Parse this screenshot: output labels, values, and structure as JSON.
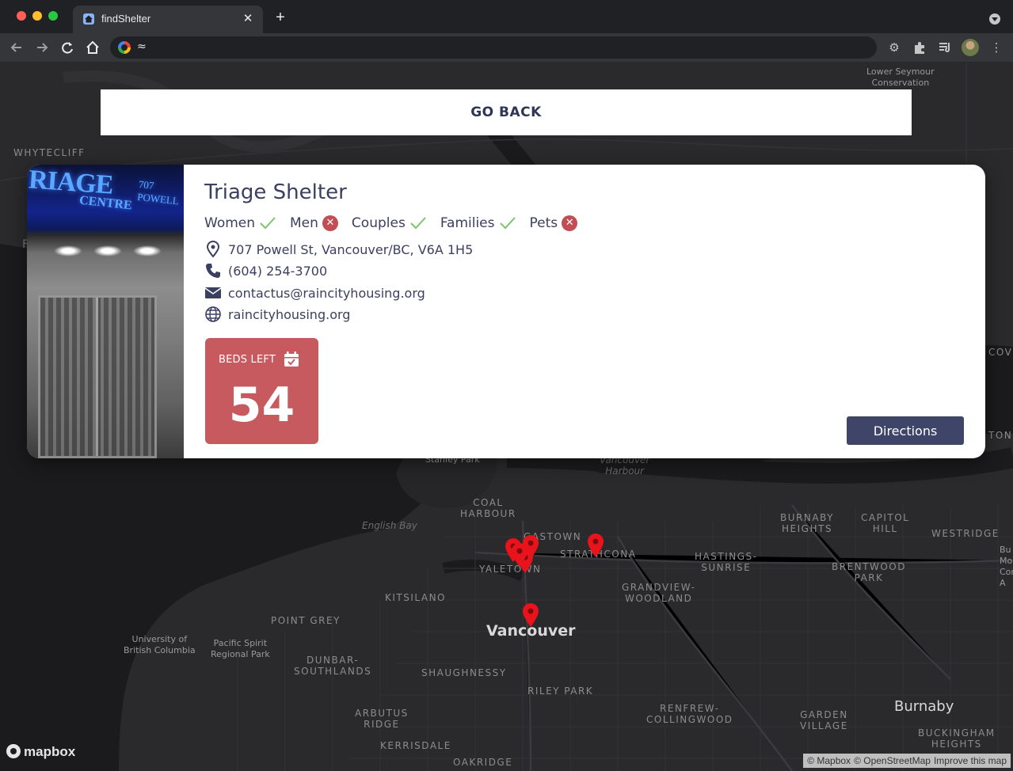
{
  "browser": {
    "tab_title": "findShelter",
    "tab_close": "✕",
    "new_tab": "+",
    "url": "≈",
    "icons": [
      "back-icon",
      "forward-icon",
      "reload-icon",
      "home-icon",
      "settings-icon",
      "extensions-icon",
      "media-icon",
      "profile-avatar",
      "menu-icon"
    ]
  },
  "go_back_label": "GO BACK",
  "shelter": {
    "name": "Triage Shelter",
    "photo_sign": "RIAGE",
    "photo_sign_sub": "CENTRE",
    "photo_sign_addr": "707 POWELL",
    "accepts": [
      {
        "label": "Women",
        "allowed": true
      },
      {
        "label": "Men",
        "allowed": false
      },
      {
        "label": "Couples",
        "allowed": true
      },
      {
        "label": "Families",
        "allowed": true
      },
      {
        "label": "Pets",
        "allowed": false
      }
    ],
    "address": "707 Powell St, Vancouver/BC, V6A 1H5",
    "phone": "(604) 254-3700",
    "email": "contactus@raincityhousing.org",
    "website": "raincityhousing.org",
    "beds_left_label": "BEDS LEFT",
    "beds_left": "54",
    "directions_label": "Directions"
  },
  "map": {
    "labels": {
      "whytecliff": "WHYTECLIFF",
      "lower_seymour": "Lower Seymour\nConservation\nve",
      "stanley_park": "Stanley Park",
      "vancouver_harbour": "Vancouver\nHarbour",
      "coal_harbour": "COAL\nHARBOUR",
      "english_bay": "English Bay",
      "gastown": "GASTOWN",
      "strathcona": "STRATHCONA",
      "yaletown": "YALETOWN",
      "kitsilano": "KITSILANO",
      "point_grey": "POINT GREY",
      "ubc": "University of\nBritish Columbia",
      "pacific_spirit": "Pacific Spirit\nRegional Park",
      "vancouver": "Vancouver",
      "dunbar": "DUNBAR-\nSOUTHLANDS",
      "shaughnessy": "SHAUGHNESSY",
      "riley_park": "RILEY PARK",
      "arbutus": "ARBUTUS\nRIDGE",
      "kerrisdale": "KERRISDALE",
      "oakridge": "OAKRIDGE",
      "grandview": "GRANDVIEW-\nWOODLAND",
      "hastings": "HASTINGS-\nSUNRISE",
      "renfrew": "RENFREW-\nCOLLINGWOOD",
      "burnaby_heights": "BURNABY\nHEIGHTS",
      "capitol_hill": "CAPITOL\nHILL",
      "westridge": "WESTRIDGE",
      "brentwood": "BRENTWOOD\nPARK",
      "garden_village": "GARDEN\nVILLAGE",
      "burnaby": "Burnaby",
      "buckingham": "BUCKINGHAM\nHEIGHTS",
      "cove": "COVE",
      "ton": "TON",
      "bu": "Bu\nMo\nCons\nA",
      "f": "F"
    },
    "pin_count": 6,
    "mapbox_logo": "mapbox",
    "attribution": [
      "© Mapbox",
      "© OpenStreetMap",
      "Improve this map"
    ],
    "pin_color": "#e8131b"
  },
  "colors": {
    "accent": "#3f4569",
    "text": "#3b4061",
    "beds_bg": "#c65a5e",
    "check": "#7cc46d",
    "cross": "#c24e55"
  }
}
